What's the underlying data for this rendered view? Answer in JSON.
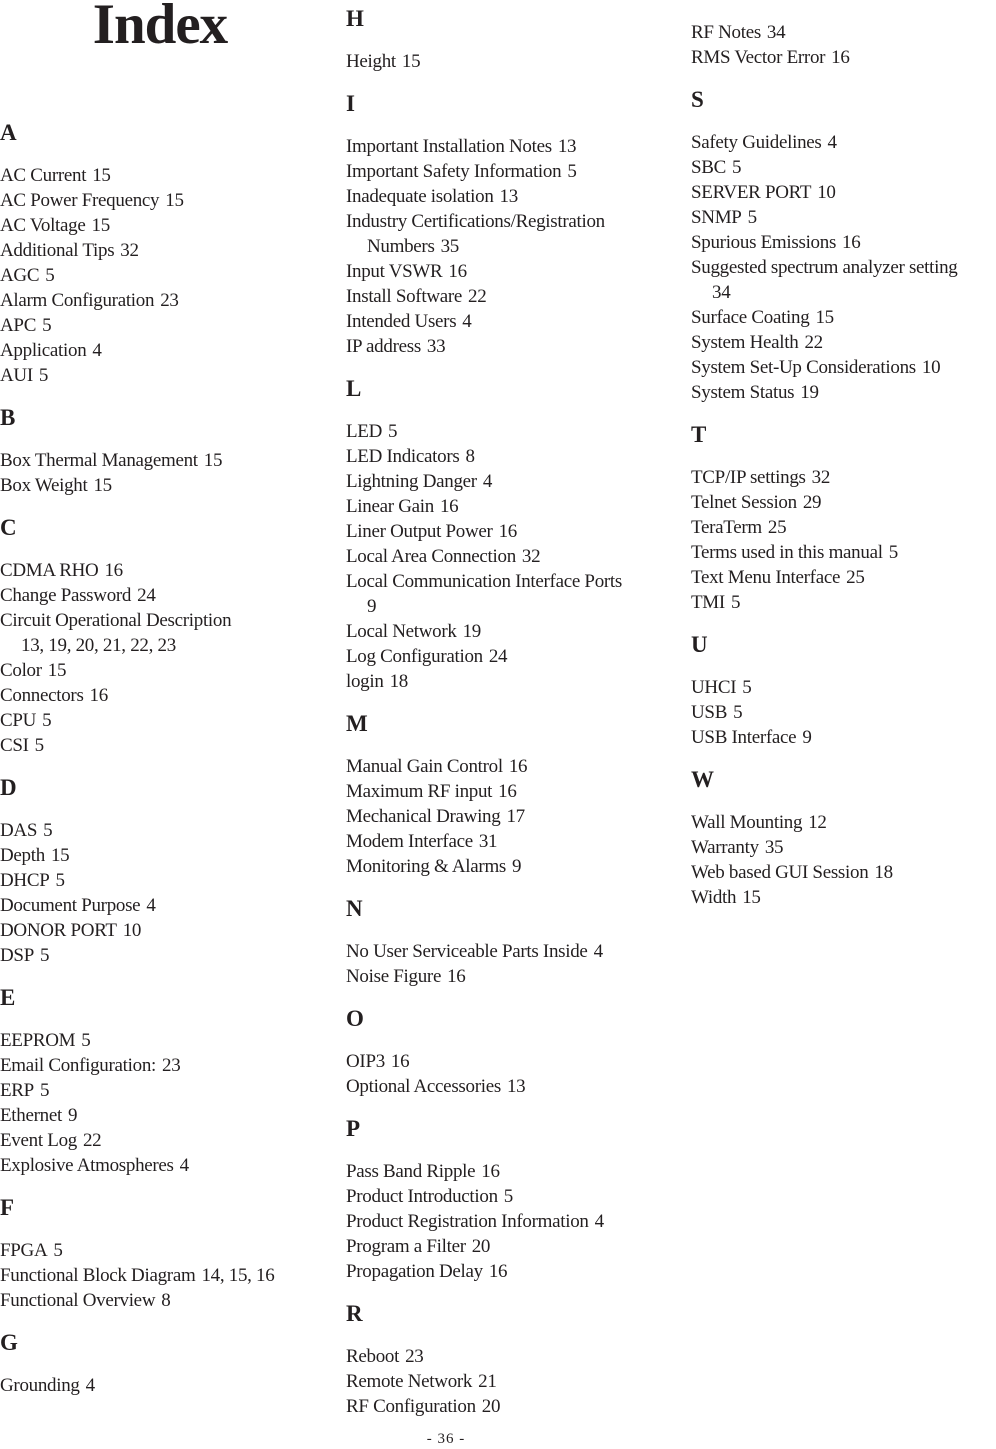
{
  "title": "Index",
  "footer": "- 36 -",
  "columns": [
    {
      "sections": [
        {
          "letter": "A",
          "entries": [
            {
              "term": "AC Current",
              "pages": "15"
            },
            {
              "term": "AC Power Frequency",
              "pages": "15"
            },
            {
              "term": "AC Voltage",
              "pages": "15"
            },
            {
              "term": "Additional Tips",
              "pages": "32"
            },
            {
              "term": "AGC",
              "pages": "5"
            },
            {
              "term": "Alarm Configuration",
              "pages": "23"
            },
            {
              "term": "APC",
              "pages": "5"
            },
            {
              "term": "Application",
              "pages": "4"
            },
            {
              "term": "AUI",
              "pages": "5"
            }
          ]
        },
        {
          "letter": "B",
          "entries": [
            {
              "term": "Box Thermal Management",
              "pages": "15"
            },
            {
              "term": "Box Weight",
              "pages": "15"
            }
          ]
        },
        {
          "letter": "C",
          "entries": [
            {
              "term": "CDMA RHO",
              "pages": "16"
            },
            {
              "term": "Change Password",
              "pages": "24"
            },
            {
              "term": "Circuit Operational Description",
              "pages": "13,  19,  20,  21,  22,  23",
              "wrap": true
            },
            {
              "term": "Color",
              "pages": "15"
            },
            {
              "term": "Connectors",
              "pages": "16"
            },
            {
              "term": "CPU",
              "pages": "5"
            },
            {
              "term": "CSI",
              "pages": "5"
            }
          ]
        },
        {
          "letter": "D",
          "entries": [
            {
              "term": "DAS",
              "pages": "5"
            },
            {
              "term": "Depth",
              "pages": "15"
            },
            {
              "term": "DHCP",
              "pages": "5"
            },
            {
              "term": "Document Purpose",
              "pages": "4"
            },
            {
              "term": "DONOR PORT",
              "pages": "10"
            },
            {
              "term": "DSP",
              "pages": "5"
            }
          ]
        },
        {
          "letter": "E",
          "entries": [
            {
              "term": "EEPROM",
              "pages": "5"
            },
            {
              "term": "Email Configuration:",
              "pages": "23"
            },
            {
              "term": "ERP",
              "pages": "5"
            },
            {
              "term": "Ethernet",
              "pages": "9"
            },
            {
              "term": "Event Log",
              "pages": "22"
            },
            {
              "term": "Explosive Atmospheres",
              "pages": "4"
            }
          ]
        },
        {
          "letter": "F",
          "entries": [
            {
              "term": "FPGA",
              "pages": "5"
            },
            {
              "term": "Functional Block Diagram",
              "pages": "14,  15,  16"
            },
            {
              "term": "Functional Overview",
              "pages": "8"
            }
          ]
        },
        {
          "letter": "G",
          "entries": [
            {
              "term": "Grounding",
              "pages": "4"
            }
          ]
        }
      ]
    },
    {
      "sections": [
        {
          "letter": "H",
          "entries": [
            {
              "term": "Height",
              "pages": "15"
            }
          ]
        },
        {
          "letter": "I",
          "entries": [
            {
              "term": "Important Installation Notes",
              "pages": "13"
            },
            {
              "term": "Important Safety Information",
              "pages": "5"
            },
            {
              "term": "Inadequate isolation",
              "pages": "13"
            },
            {
              "term": "Industry Certifications/Registration",
              "cont": "Numbers",
              "pages": "35",
              "wrap": true
            },
            {
              "term": "Input VSWR",
              "pages": "16"
            },
            {
              "term": "Install Software",
              "pages": "22"
            },
            {
              "term": "Intended Users",
              "pages": "4"
            },
            {
              "term": "IP address",
              "pages": "33"
            }
          ]
        },
        {
          "letter": "L",
          "entries": [
            {
              "term": "LED",
              "pages": "5"
            },
            {
              "term": "LED Indicators",
              "pages": "8"
            },
            {
              "term": "Lightning Danger",
              "pages": "4"
            },
            {
              "term": "Linear Gain",
              "pages": "16"
            },
            {
              "term": "Liner Output Power",
              "pages": "16"
            },
            {
              "term": "Local Area Connection",
              "pages": "32"
            },
            {
              "term": "Local Communication Interface Ports",
              "pages": "9",
              "wrap": true
            },
            {
              "term": "Local Network",
              "pages": "19"
            },
            {
              "term": "Log Configuration",
              "pages": "24"
            },
            {
              "term": "login",
              "pages": "18"
            }
          ]
        },
        {
          "letter": "M",
          "entries": [
            {
              "term": "Manual Gain Control",
              "pages": "16"
            },
            {
              "term": "Maximum RF input",
              "pages": "16"
            },
            {
              "term": "Mechanical Drawing",
              "pages": "17"
            },
            {
              "term": "Modem Interface",
              "pages": "31"
            },
            {
              "term": "Monitoring & Alarms",
              "pages": "9"
            }
          ]
        },
        {
          "letter": "N",
          "entries": [
            {
              "term": "No User Serviceable Parts Inside",
              "pages": "4"
            },
            {
              "term": "Noise Figure",
              "pages": "16"
            }
          ]
        },
        {
          "letter": "O",
          "entries": [
            {
              "term": "OIP3",
              "pages": "16"
            },
            {
              "term": "Optional Accessories",
              "pages": "13"
            }
          ]
        },
        {
          "letter": "P",
          "entries": [
            {
              "term": "Pass Band Ripple",
              "pages": "16"
            },
            {
              "term": "Product Introduction",
              "pages": "5"
            },
            {
              "term": "Product Registration Information",
              "pages": "4"
            },
            {
              "term": "Program a Filter",
              "pages": "20"
            },
            {
              "term": "Propagation Delay",
              "pages": "16"
            }
          ]
        },
        {
          "letter": "R",
          "entries": [
            {
              "term": "Reboot",
              "pages": "23"
            },
            {
              "term": "Remote Network",
              "pages": "21"
            },
            {
              "term": "RF Configuration",
              "pages": "20"
            }
          ]
        }
      ]
    },
    {
      "sections": [
        {
          "letter": "",
          "entries": [
            {
              "term": "RF Notes",
              "pages": "34"
            },
            {
              "term": "RMS Vector Error",
              "pages": "16"
            }
          ]
        },
        {
          "letter": "S",
          "entries": [
            {
              "term": "Safety Guidelines",
              "pages": "4"
            },
            {
              "term": "SBC",
              "pages": "5"
            },
            {
              "term": "SERVER PORT",
              "pages": "10"
            },
            {
              "term": "SNMP",
              "pages": "5"
            },
            {
              "term": "Spurious Emissions",
              "pages": "16"
            },
            {
              "term": "Suggested spectrum analyzer setting",
              "pages": "34",
              "wrap": true
            },
            {
              "term": "Surface Coating",
              "pages": "15"
            },
            {
              "term": "System Health",
              "pages": "22"
            },
            {
              "term": "System Set-Up Considerations",
              "pages": "10"
            },
            {
              "term": "System Status",
              "pages": "19"
            }
          ]
        },
        {
          "letter": "T",
          "entries": [
            {
              "term": "TCP/IP settings",
              "pages": "32"
            },
            {
              "term": "Telnet Session",
              "pages": "29"
            },
            {
              "term": "TeraTerm",
              "pages": "25"
            },
            {
              "term": "Terms used in this manual",
              "pages": "5"
            },
            {
              "term": "Text Menu Interface",
              "pages": "25"
            },
            {
              "term": "TMI",
              "pages": "5"
            }
          ]
        },
        {
          "letter": "U",
          "entries": [
            {
              "term": "UHCI",
              "pages": "5"
            },
            {
              "term": "USB",
              "pages": "5"
            },
            {
              "term": "USB Interface",
              "pages": "9"
            }
          ]
        },
        {
          "letter": "W",
          "entries": [
            {
              "term": "Wall Mounting",
              "pages": "12"
            },
            {
              "term": "Warranty",
              "pages": "35"
            },
            {
              "term": "Web based GUI Session",
              "pages": "18"
            },
            {
              "term": "Width",
              "pages": "15"
            }
          ]
        }
      ]
    }
  ]
}
